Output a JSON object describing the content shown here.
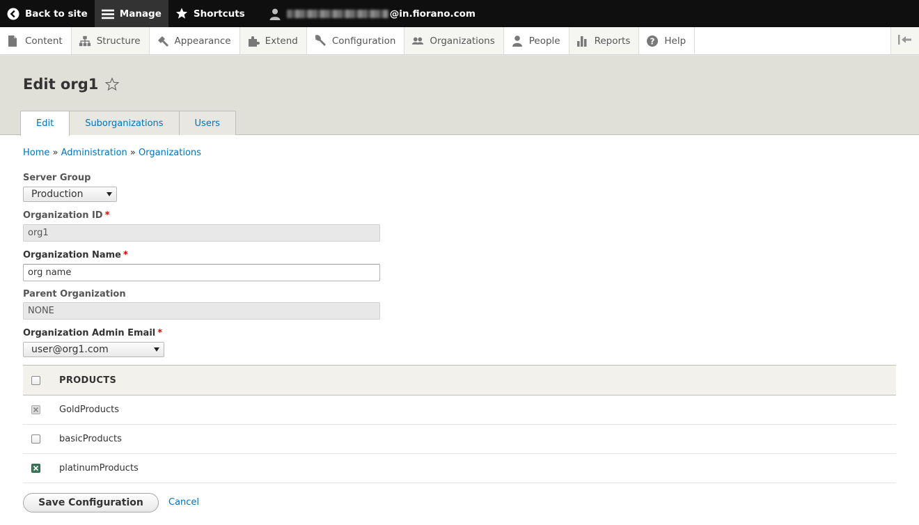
{
  "toolbar": {
    "back_label": "Back to site",
    "manage_label": "Manage",
    "shortcuts_label": "Shortcuts",
    "user_email_suffix": "@in.fiorano.com"
  },
  "tray": {
    "items": [
      {
        "label": "Content",
        "icon": "file-icon"
      },
      {
        "label": "Structure",
        "icon": "sitemap-icon"
      },
      {
        "label": "Appearance",
        "icon": "paintbrush-icon"
      },
      {
        "label": "Extend",
        "icon": "puzzle-icon"
      },
      {
        "label": "Configuration",
        "icon": "wrench-icon"
      },
      {
        "label": "Organizations",
        "icon": "group-icon"
      },
      {
        "label": "People",
        "icon": "person-icon"
      },
      {
        "label": "Reports",
        "icon": "bar-chart-icon"
      },
      {
        "label": "Help",
        "icon": "help-icon"
      }
    ]
  },
  "page": {
    "title": "Edit org1",
    "tabs": [
      {
        "label": "Edit"
      },
      {
        "label": "Suborganizations"
      },
      {
        "label": "Users"
      }
    ]
  },
  "breadcrumb": {
    "home": "Home",
    "sep": "»",
    "admin": "Administration",
    "orgs": "Organizations"
  },
  "form": {
    "server_group_label": "Server Group",
    "server_group_value": "Production",
    "org_id_label": "Organization ID",
    "org_id_value": "org1",
    "org_name_label": "Organization Name",
    "org_name_value": "org name",
    "parent_label": "Parent Organization",
    "parent_value": "NONE",
    "admin_email_label": "Organization Admin Email",
    "admin_email_value": "user@org1.com",
    "required_mark": "*"
  },
  "products": {
    "header": "PRODUCTS",
    "rows": [
      {
        "name": "GoldProducts",
        "state": "checked-disabled"
      },
      {
        "name": "basicProducts",
        "state": "unchecked"
      },
      {
        "name": "platinumProducts",
        "state": "checked"
      }
    ]
  },
  "actions": {
    "save_label": "Save Configuration",
    "cancel_label": "Cancel"
  }
}
